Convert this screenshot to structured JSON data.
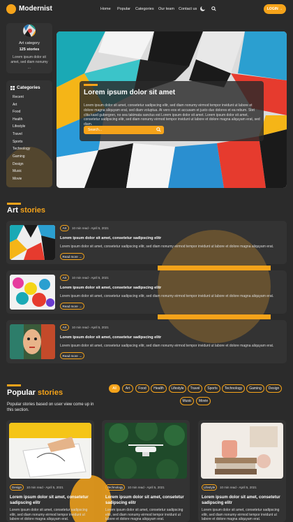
{
  "header": {
    "brand": "Modernist",
    "nav": [
      "Home",
      "Popular",
      "Categories",
      "Our team",
      "Contact us"
    ],
    "login": "LOGIN →"
  },
  "sidebar": {
    "category_label": "Art category",
    "category_count": "125 stories",
    "category_desc": "Lorem ipsum dolor sit amet, sed diam nonumy ...",
    "categories_heading": "Categories",
    "categories": [
      "Recent",
      "Art",
      "Food",
      "Health",
      "Lifestyle",
      "Travel",
      "Sports",
      "Technology",
      "Gaming",
      "Design",
      "Music",
      "Movie"
    ]
  },
  "hero": {
    "title": "Lorem ipsum dolor sit amet",
    "text": "Lorem ipsum dolor sit amet, consetetur sadipscing elitr, sed diam nonumy eirmod tempor invidunt ut labore et dolore magna aliquyam erat, sed diam voluptua. At vero eos et accusam et justo duo dolores et ea rebum. Stet clita kasd gubergren, no sea takimata sanctus est Lorem ipsum dolor sit amet. Lorem ipsum dolor sit amet, consetetur sadipscing elitr, sed diam nonumy eirmod tempor invidunt ut labore et dolore magna aliquyam erat, sed diam.",
    "search_placeholder": "Search..."
  },
  "art": {
    "title_white": "Art",
    "title_orange": "stories",
    "stories": [
      {
        "tag": "Art",
        "meta": "10 min read - April 5, 2021",
        "title": "Lorem ipsum dolor sit amet, consetetur sadipscing elitr",
        "text": "Lorem ipsum dolor sit amet, consetetur sadipscing elitr, sed diam nonumy eirmod tempor invidunt ut labore et dolore magna aliquyam erat.",
        "button": "Read more →"
      },
      {
        "tag": "Art",
        "meta": "10 min read - April 5, 2021",
        "title": "Lorem ipsum dolor sit amet, consetetur sadipscing elitr",
        "text": "Lorem ipsum dolor sit amet, consetetur sadipscing elitr, sed diam nonumy eirmod tempor invidunt ut labore et dolore magna aliquyam erat.",
        "button": "Read more →"
      },
      {
        "tag": "Art",
        "meta": "10 min read - April 5, 2021",
        "title": "Lorem ipsum dolor sit amet, consetetur sadipscing elitr",
        "text": "Lorem ipsum dolor sit amet, consetetur sadipscing elitr, sed diam nonumy eirmod tempor invidunt ut labore et dolore magna aliquyam erat.",
        "button": "Read more →"
      }
    ]
  },
  "popular": {
    "title_white": "Popular",
    "title_orange": "stories",
    "subtitle": "Popular stories based on user view come up in this section.",
    "filters": [
      "All",
      "Art",
      "Food",
      "Health",
      "Lifestyle",
      "Travel",
      "Sports",
      "Technology",
      "Gaming",
      "Design",
      "Music",
      "Movie"
    ],
    "cards": [
      {
        "tag": "Design",
        "meta": "10 min read - April 5, 2021",
        "title": "Lorem ipsum dolor sit amet, consetetur sadipscing elitr",
        "text": "Lorem ipsum dolor sit amet, consetetur sadipscing elitr, sed diam nonumy eirmod tempor invidunt ut labore et dolore magna aliquyam erat."
      },
      {
        "tag": "Technology",
        "meta": "10 min read - April 5, 2021",
        "title": "Lorem ipsum dolor sit amet, consetetur sadipscing elitr",
        "text": "Lorem ipsum dolor sit amet, consetetur sadipscing elitr, sed diam nonumy eirmod tempor invidunt ut labore et dolore magna aliquyam erat."
      },
      {
        "tag": "Lifestyle",
        "meta": "10 min read - April 5, 2021",
        "title": "Lorem ipsum dolor sit amet, consetetur sadipscing elitr",
        "text": "Lorem ipsum dolor sit amet, consetetur sadipscing elitr, sed diam nonumy eirmod tempor invidunt ut labore et dolore magna aliquyam erat."
      }
    ]
  },
  "colors": {
    "accent": "#f5a31a",
    "background": "#2b2b2b",
    "card": "#333333"
  },
  "icons": [
    "moon-icon",
    "search-icon",
    "grid-icon",
    "arrow-right-icon"
  ]
}
